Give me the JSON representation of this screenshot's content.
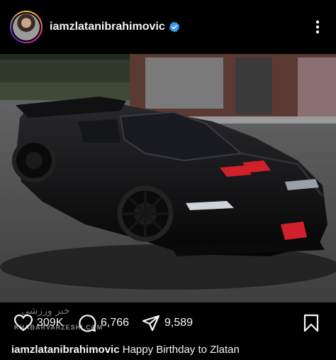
{
  "post": {
    "username": "iamzlatanibrahimovic",
    "verified": true,
    "image_alt": "Black hypercar parked on asphalt in front of a building",
    "icons": {
      "avatar": "profile-avatar",
      "verified": "verified-badge-icon",
      "more": "more-options-icon",
      "like": "heart-icon",
      "comment": "comment-bubble-icon",
      "share": "send-paper-plane-icon",
      "save": "bookmark-icon"
    },
    "stats": {
      "likes": "309K",
      "comments": "6,766",
      "shares": "9,589"
    },
    "watermark": "KHABARVARZESHI.COM",
    "watermark_script": "خبر ورزشی",
    "caption": {
      "username": "iamzlatanibrahimovic",
      "text": "Happy Birthday to Zlatan"
    }
  },
  "colors": {
    "background": "#000000",
    "text": "#f5f5f5",
    "verified": "#3897f0",
    "car_lights": "#d0202a"
  }
}
